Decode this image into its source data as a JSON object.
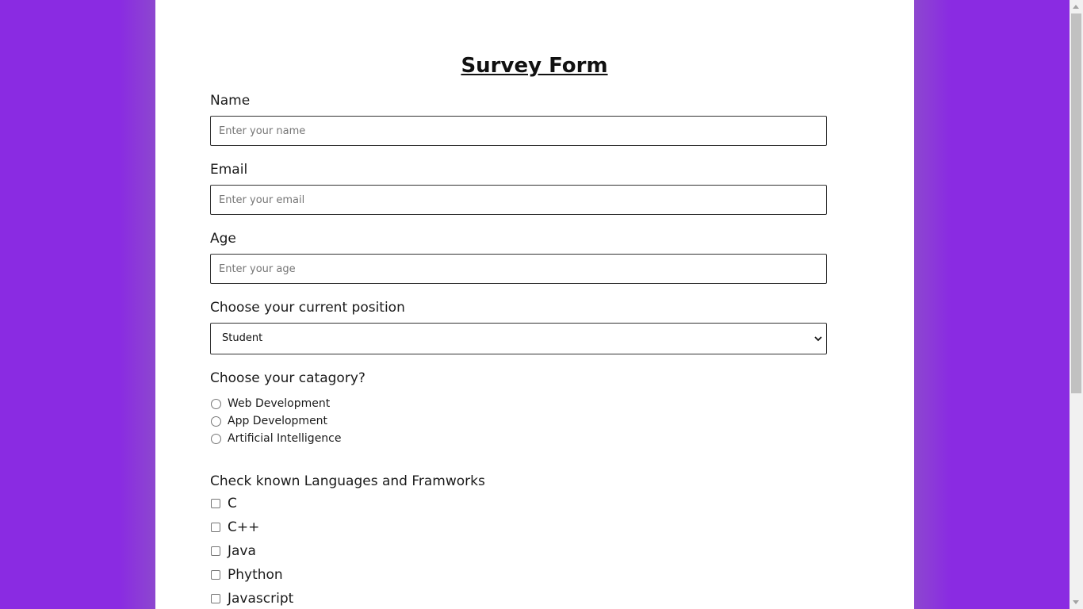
{
  "page": {
    "title": "Survey Form",
    "background_color": "#8a2be2",
    "card_color": "#ffffff"
  },
  "fields": {
    "name": {
      "label": "Name",
      "placeholder": "Enter your name",
      "value": ""
    },
    "email": {
      "label": "Email",
      "placeholder": "Enter your email",
      "value": ""
    },
    "age": {
      "label": "Age",
      "placeholder": "Enter your age",
      "value": ""
    }
  },
  "position": {
    "label": "Choose your current position",
    "selected": "Student",
    "icon": "chevron-down-icon"
  },
  "category": {
    "label": "Choose your catagory?",
    "options": [
      "Web Development",
      "App Development",
      "Artificial Intelligence"
    ]
  },
  "languages": {
    "label": "Check known Languages and Framworks",
    "options": [
      "C",
      "C++",
      "Java",
      "Phython",
      "Javascript"
    ]
  }
}
